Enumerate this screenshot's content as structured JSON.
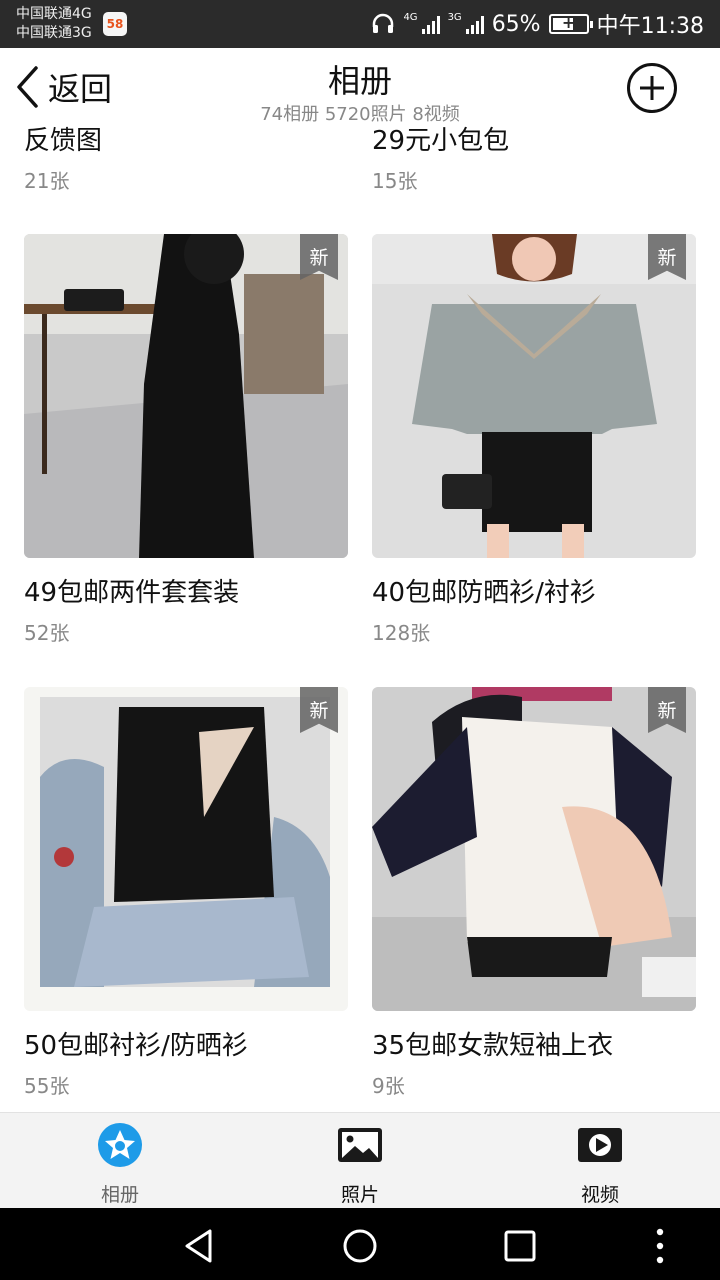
{
  "status_bar": {
    "carrier_1": "中国联通4G",
    "carrier_2": "中国联通3G",
    "app_badge": "58",
    "net_4g": "4G",
    "net_3g": "3G",
    "battery_level": 0.65,
    "battery": "65%",
    "time": "中午11:38"
  },
  "header": {
    "back_label": "返回",
    "title": "相册",
    "subtitle": "74相册 5720照片 8视频",
    "add_icon": "plus-circle-icon"
  },
  "albums": [
    {
      "name": "反馈图",
      "count": "21张",
      "badge": ""
    },
    {
      "name": "29元小包包",
      "count": "15张",
      "badge": ""
    },
    {
      "name": "49包邮两件套套装",
      "count": "52张",
      "badge": "新"
    },
    {
      "name": "40包邮防晒衫/衬衫",
      "count": "128张",
      "badge": "新"
    },
    {
      "name": "50包邮衬衫/防晒衫",
      "count": "55张",
      "badge": "新"
    },
    {
      "name": "35包邮女款短袖上衣",
      "count": "9张",
      "badge": "新"
    }
  ],
  "tabs": [
    {
      "label": "相册",
      "icon": "album-star-icon",
      "active": true
    },
    {
      "label": "照片",
      "icon": "photo-icon",
      "active": false
    },
    {
      "label": "视频",
      "icon": "video-play-icon",
      "active": false
    }
  ],
  "nav_bar": {
    "back_icon": "triangle-back-icon",
    "home_icon": "circle-home-icon",
    "recents_icon": "square-recents-icon",
    "menu_icon": "vertical-dots-icon"
  },
  "colors": {
    "accent": "#1e9be8",
    "status_bar_bg": "#2b2b2b",
    "tabbar_bg": "#f3f3f3",
    "badge_bg": "#646464"
  }
}
